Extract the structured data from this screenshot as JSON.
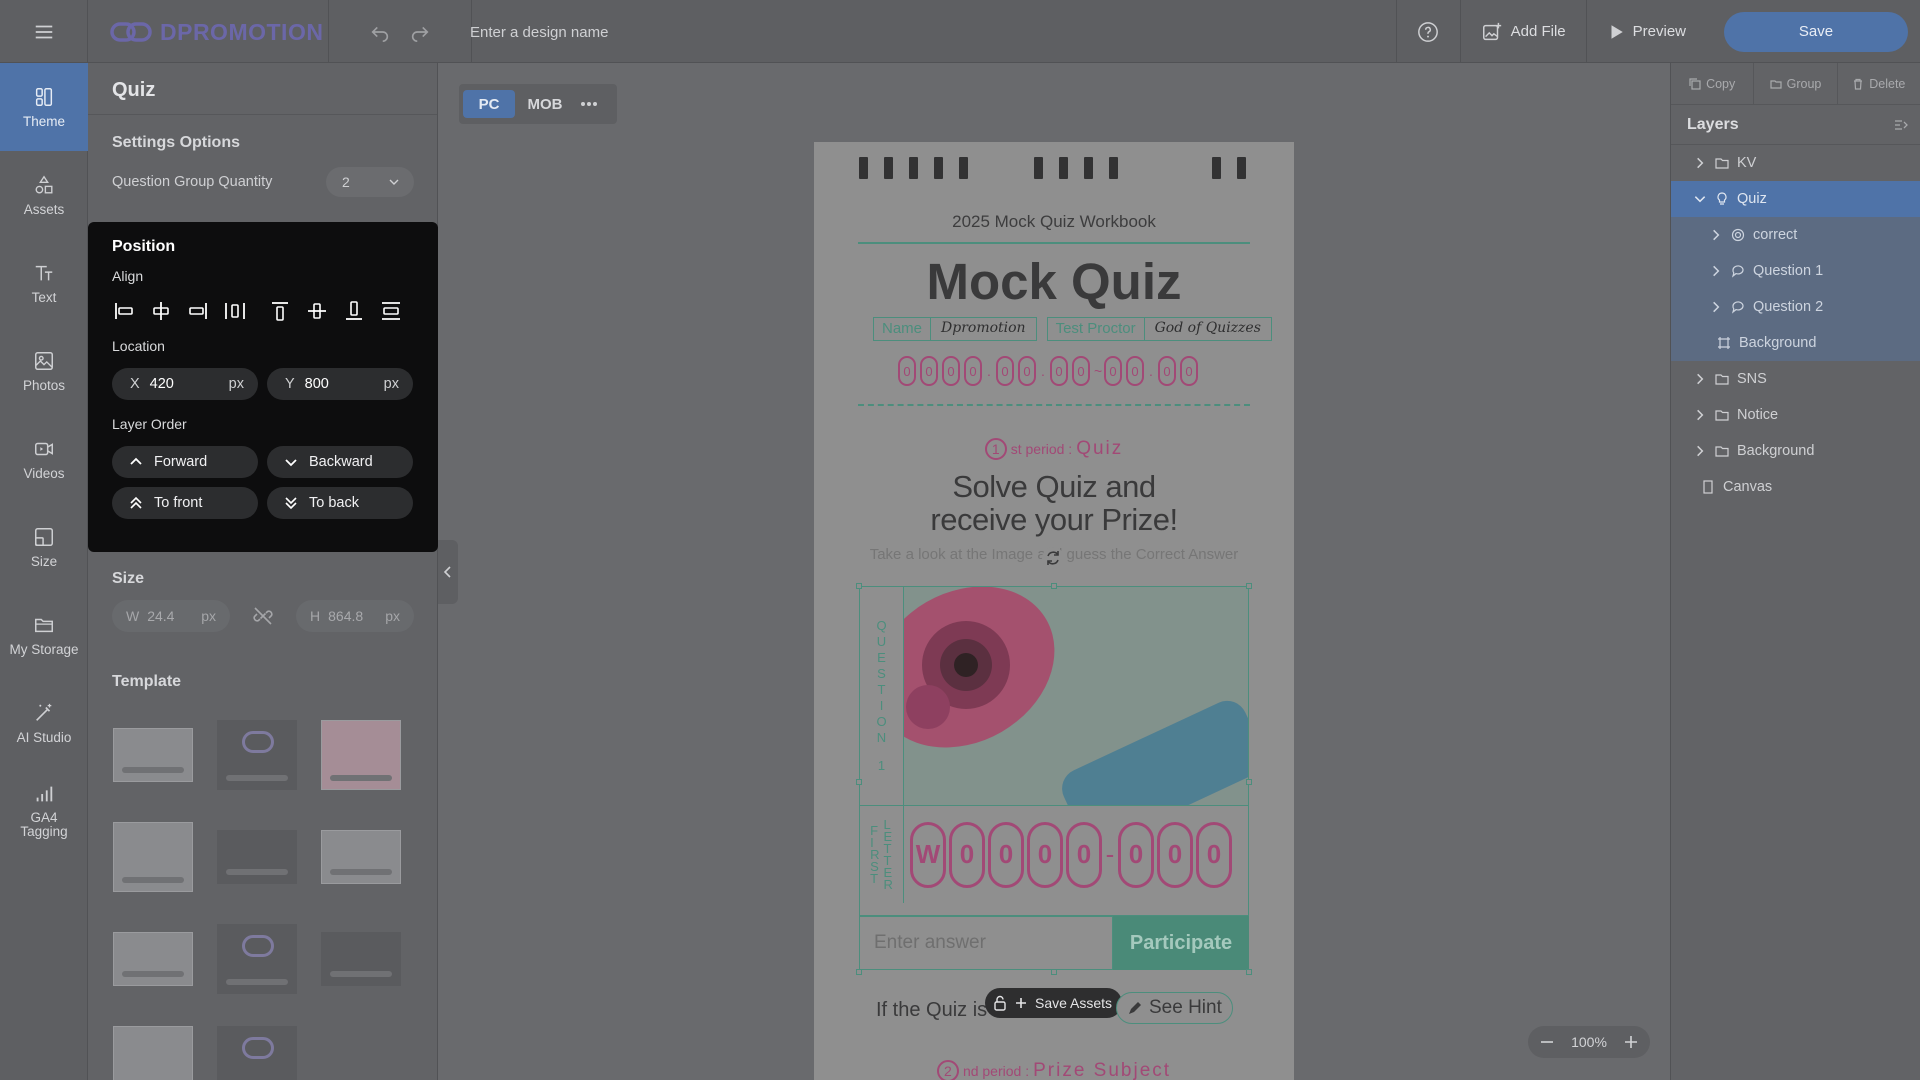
{
  "app": {
    "logo_text": "DPROMOTION",
    "design_name_placeholder": "Enter a design name",
    "help_icon": "help-circle-icon",
    "add_file_label": "Add File",
    "preview_label": "Preview",
    "save_label": "Save",
    "accent_color": "#4f73a8"
  },
  "nav": {
    "items": [
      {
        "label": "Theme",
        "icon": "theme-icon",
        "active": true
      },
      {
        "label": "Assets",
        "icon": "shapes-icon"
      },
      {
        "label": "Text",
        "icon": "text-icon"
      },
      {
        "label": "Photos",
        "icon": "photo-icon"
      },
      {
        "label": "Videos",
        "icon": "video-icon"
      },
      {
        "label": "Size",
        "icon": "resize-icon"
      },
      {
        "label": "My Storage",
        "icon": "folder-icon"
      },
      {
        "label": "AI Studio",
        "icon": "magic-wand-icon"
      },
      {
        "label": "GA4 Tagging",
        "icon": "analytics-icon"
      }
    ]
  },
  "panel": {
    "title": "Quiz",
    "settings_title": "Settings Options",
    "question_group_label": "Question Group Quantity",
    "question_group_value": "2",
    "size_title": "Size",
    "width_axis": "W",
    "width_value": "24.4",
    "height_axis": "H",
    "height_value": "864.8",
    "unit": "px",
    "template_title": "Template"
  },
  "position": {
    "title": "Position",
    "align_label": "Align",
    "location_label": "Location",
    "x_axis": "X",
    "x_value": "420",
    "y_axis": "Y",
    "y_value": "800",
    "unit": "px",
    "layer_order_label": "Layer Order",
    "forward": "Forward",
    "backward": "Backward",
    "to_front": "To front",
    "to_back": "To back"
  },
  "canvas": {
    "device_pc": "PC",
    "device_mob": "MOB",
    "zoom": "100%",
    "subhead": "2025 Mock Quiz Workbook",
    "title": "Mock Quiz",
    "name_label": "Name",
    "name_value": "Dpromotion",
    "proctor_label": "Test Proctor",
    "proctor_value": "God of Quizzes",
    "date_digits": [
      "0",
      "0",
      "0",
      "0",
      ".",
      "0",
      "0",
      ".",
      "0",
      "0",
      "~",
      "0",
      "0",
      ".",
      "0",
      "0"
    ],
    "period1_num": "1",
    "period1_suffix": "st period :",
    "period1_word": "Quiz",
    "headline_1": "Solve Quiz and",
    "headline_2": "receive your Prize!",
    "hint_line": "Take a look at the Image and guess the Correct Answer",
    "question_letters": [
      "Q",
      "U",
      "E",
      "S",
      "T",
      "I",
      "O",
      "N"
    ],
    "question_number": "1",
    "first_letters": [
      "F",
      "I",
      "R",
      "S",
      "T"
    ],
    "letter_letters": [
      "L",
      "E",
      "T",
      "T",
      "E",
      "R"
    ],
    "answer_slots": [
      "W",
      "0",
      "0",
      "0",
      "0",
      "-",
      "0",
      "0",
      "0"
    ],
    "answer_placeholder": "Enter answer",
    "participate_label": "Participate",
    "if_quiz_text": "If the Quiz is",
    "save_assets_label": "Save Assets",
    "see_hint_label": "See Hint",
    "period2_num": "2",
    "period2_suffix": "nd period :",
    "period2_word": "Prize Subject"
  },
  "right": {
    "copy_label": "Copy",
    "group_label": "Group",
    "delete_label": "Delete",
    "layers_title": "Layers",
    "layers": [
      {
        "label": "KV",
        "icon": "folder-icon",
        "indent": 0,
        "state": ""
      },
      {
        "label": "Quiz",
        "icon": "bulb-icon",
        "indent": 0,
        "state": "sel"
      },
      {
        "label": "correct",
        "icon": "target-icon",
        "indent": 1,
        "state": "sub"
      },
      {
        "label": "Question 1",
        "icon": "chat-icon",
        "indent": 1,
        "state": "sub"
      },
      {
        "label": "Question 2",
        "icon": "chat-icon",
        "indent": 1,
        "state": "sub"
      },
      {
        "label": "Background",
        "icon": "frame-icon",
        "indent": 1,
        "state": "sub"
      },
      {
        "label": "SNS",
        "icon": "folder-icon",
        "indent": 0,
        "state": ""
      },
      {
        "label": "Notice",
        "icon": "folder-icon",
        "indent": 0,
        "state": ""
      },
      {
        "label": "Background",
        "icon": "folder-icon",
        "indent": 0,
        "state": ""
      },
      {
        "label": "Canvas",
        "icon": "page-icon",
        "indent": 0,
        "state": ""
      }
    ]
  }
}
